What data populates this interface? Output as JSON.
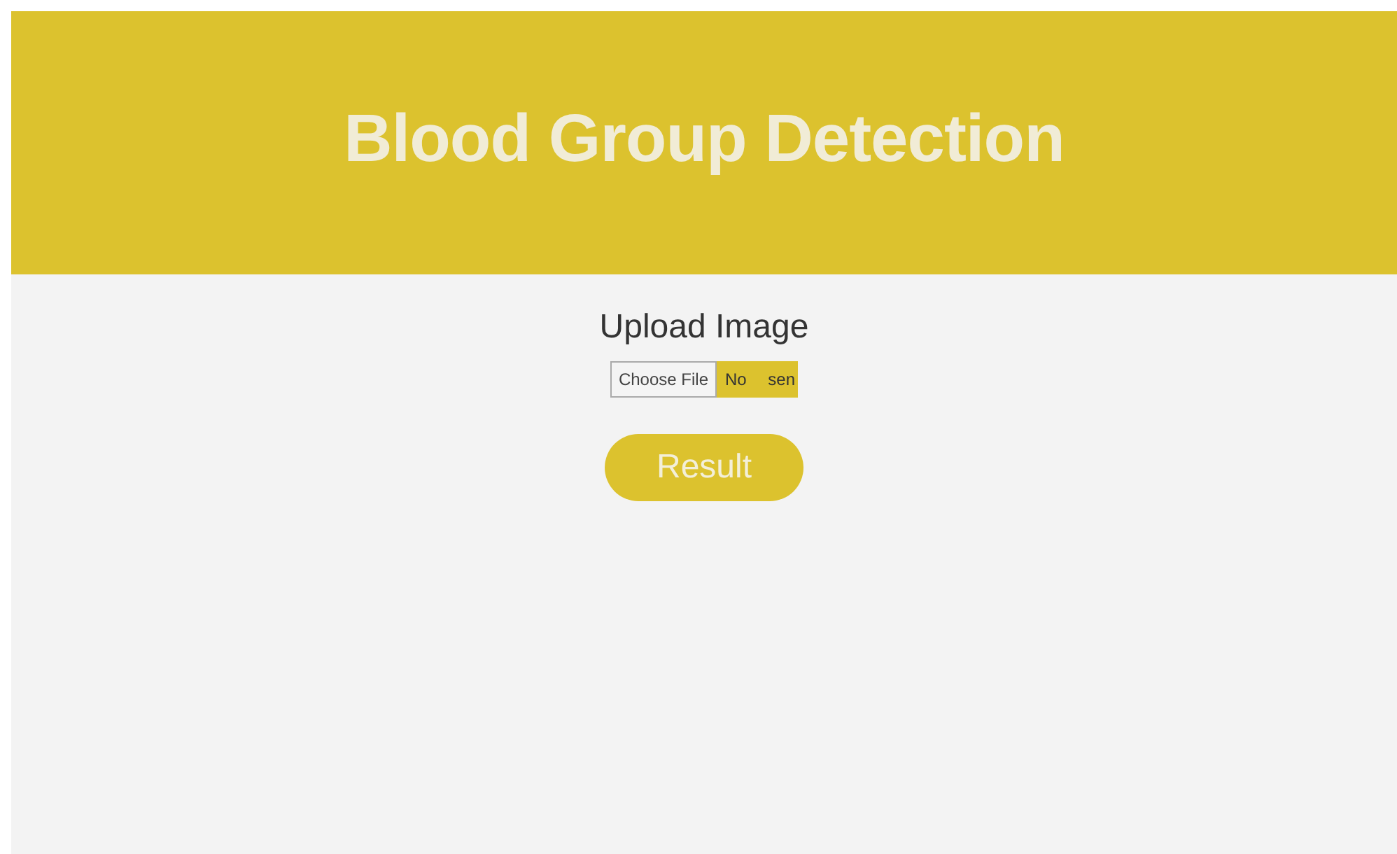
{
  "header": {
    "title": "Blood Group Detection"
  },
  "upload": {
    "label": "Upload Image",
    "button": "Choose File",
    "status": "No sen"
  },
  "result_button": "Result"
}
